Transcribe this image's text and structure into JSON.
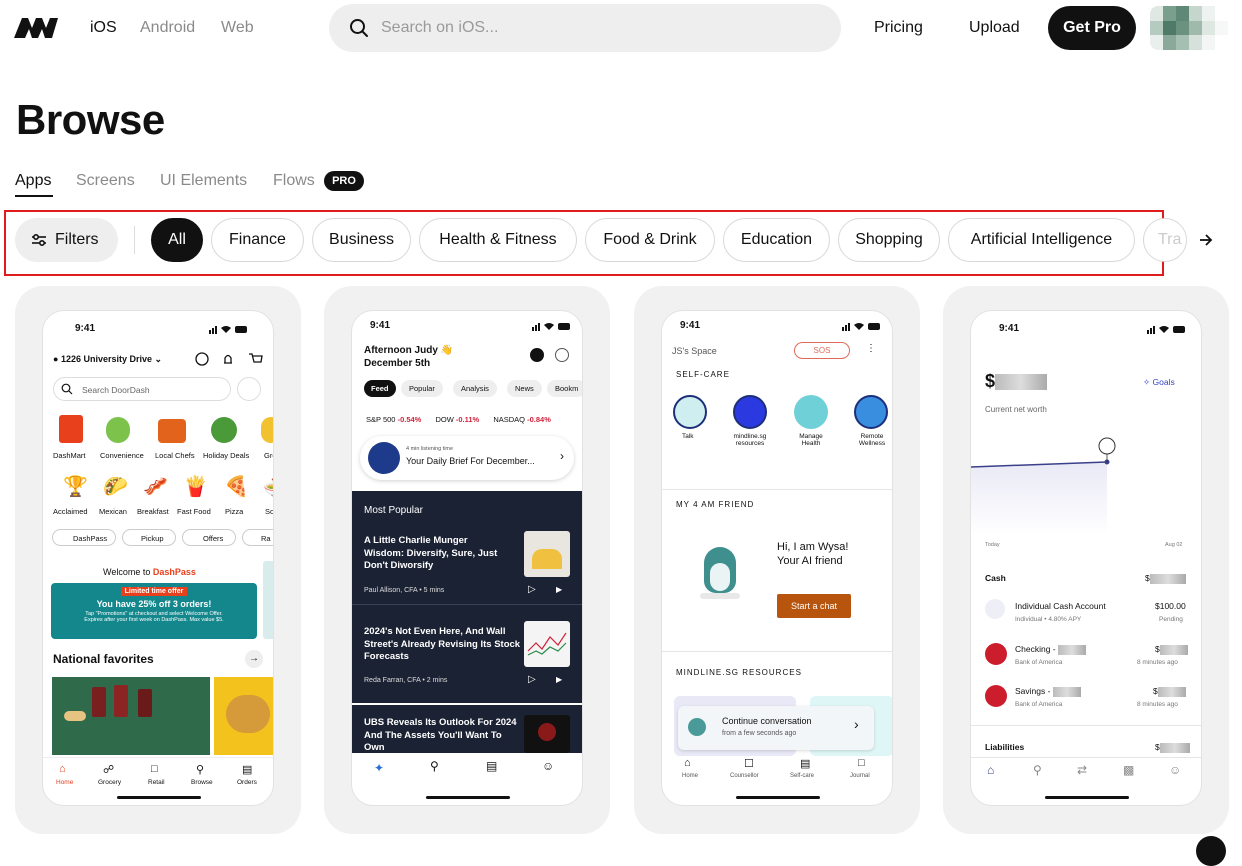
{
  "header": {
    "platforms": [
      "iOS",
      "Android",
      "Web"
    ],
    "search_placeholder": "Search on iOS...",
    "pricing": "Pricing",
    "upload": "Upload",
    "get_pro": "Get Pro"
  },
  "page_title": "Browse",
  "tabs": [
    {
      "label": "Apps"
    },
    {
      "label": "Screens"
    },
    {
      "label": "UI Elements"
    },
    {
      "label": "Flows"
    }
  ],
  "pro_badge": "PRO",
  "filters_label": "Filters",
  "categories": [
    "All",
    "Finance",
    "Business",
    "Health & Fitness",
    "Food & Drink",
    "Education",
    "Shopping",
    "Artificial Intelligence",
    "Tra"
  ],
  "colors": {
    "accent": "#111111",
    "highlight": "#e01b1b",
    "card_bg": "#f1f1f1"
  },
  "apps": [
    {
      "time": "9:41",
      "address": "1226 University Drive",
      "search": "Search DoorDash",
      "cats1": [
        "DashMart",
        "Convenience",
        "Local Chefs",
        "Holiday Deals",
        "Groc"
      ],
      "cats2": [
        "Acclaimed",
        "Mexican",
        "Breakfast",
        "Fast Food",
        "Pizza",
        "So"
      ],
      "pills": [
        "DashPass",
        "Pickup",
        "Offers",
        "Ra"
      ],
      "welcome": "Welcome to",
      "dashpass": "DashPass",
      "limited": "Limited time offer",
      "promo": "You have 25% off 3 orders!",
      "promo_sub1": "Tap \"Promotions\" at checkout and select Welcome Offer.",
      "promo_sub2": "Expires after your first week on DashPass. Max value $5.",
      "national": "National favorites",
      "nav": [
        "Home",
        "Grocery",
        "Retail",
        "Browse",
        "Orders"
      ]
    },
    {
      "time": "9:41",
      "greeting": "Afternoon Judy",
      "date": "December 5th",
      "tabs": [
        "Feed",
        "Popular",
        "Analysis",
        "News",
        "Bookm"
      ],
      "tickers": [
        {
          "name": "S&P 500",
          "value": "-0.54%"
        },
        {
          "name": "DOW",
          "value": "-0.11%"
        },
        {
          "name": "NASDAQ",
          "value": "-0.84%"
        }
      ],
      "listen": "4 min listening time",
      "brief": "Your Daily Brief For December...",
      "most_popular": "Most Popular",
      "articles": [
        {
          "title": "A Little Charlie Munger Wisdom: Diversify, Sure, Just Don't Diworsify",
          "meta": "Paul Allison, CFA • 5 mins"
        },
        {
          "title": "2024's Not Even Here, And Wall Street's Already Revising Its Stock Forecasts",
          "meta": "Reda Farran, CFA • 2 mins"
        },
        {
          "title": "UBS Reveals Its Outlook For 2024 And The Assets You'll Want To Own",
          "meta": ""
        }
      ]
    },
    {
      "time": "9:41",
      "space": "JS's Space",
      "sos": "SOS",
      "selfcare": "SELF-CARE",
      "items": [
        "Talk",
        "mindline.sg resources",
        "Manage Health",
        "Remote Wellness"
      ],
      "friend_header": "MY 4 AM FRIEND",
      "hi": "Hi, I am Wysa!",
      "friend": "Your AI friend",
      "start_chat": "Start a chat",
      "resources": "MINDLINE.SG RESOURCES",
      "continue": "Continue conversation",
      "continue_sub": "from a few seconds ago",
      "nav": [
        "Home",
        "Counsellor",
        "Self-care",
        "Journal"
      ]
    },
    {
      "time": "9:41",
      "currency": "$",
      "goals": "Goals",
      "net_worth": "Current net worth",
      "today": "Today",
      "date_end": "Aug 02",
      "cash": "Cash",
      "accounts": [
        {
          "name": "Individual Cash Account",
          "sub": "Individual • 4.80% APY",
          "amount": "$100.00",
          "status": "Pending"
        },
        {
          "name": "Checking -",
          "sub": "Bank of America",
          "amount": "$",
          "status": "8 minutes ago"
        },
        {
          "name": "Savings -",
          "sub": "Bank of America",
          "amount": "$",
          "status": "8 minutes ago"
        }
      ],
      "liabilities": "Liabilities"
    }
  ]
}
